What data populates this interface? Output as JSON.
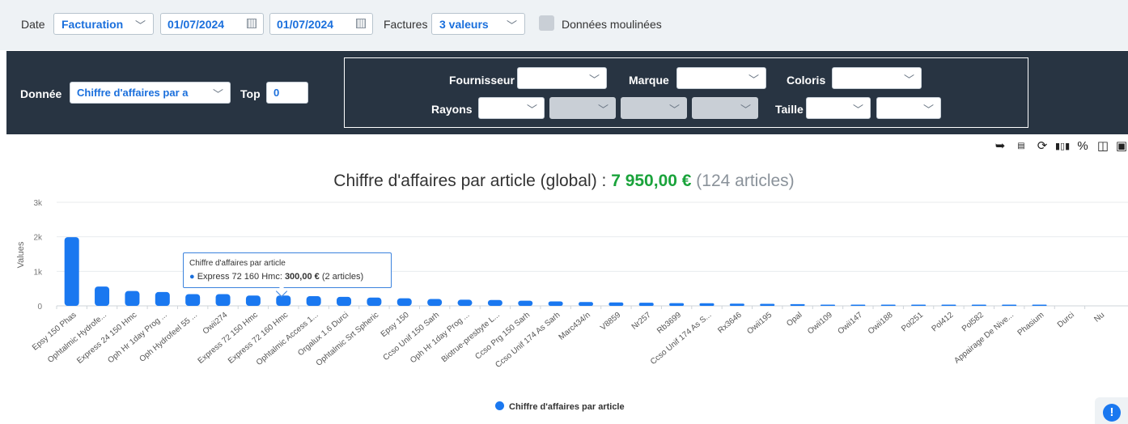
{
  "filters": {
    "date_label": "Date",
    "date_type": "Facturation",
    "date_start": "01/07/2024",
    "date_end": "01/07/2024",
    "factures_label": "Factures",
    "factures_value": "3 valeurs",
    "moulinees_label": "Données moulinées"
  },
  "panel": {
    "donnee_label": "Donnée",
    "donnee_value": "Chiffre d'affaires par a",
    "top_label": "Top",
    "top_value": "0",
    "fournisseur_label": "Fournisseur",
    "marque_label": "Marque",
    "coloris_label": "Coloris",
    "rayons_label": "Rayons",
    "taille_label": "Taille"
  },
  "toolbar": {
    "icons": [
      "export-icon",
      "csv-icon",
      "refresh-icon",
      "bar-chart-icon",
      "percent-icon",
      "columns-icon",
      "save-icon"
    ]
  },
  "chart": {
    "title_main": "Chiffre d'affaires par article (global) : ",
    "title_total": "7 950,00 €",
    "title_count": "(124 articles)",
    "y_axis_label": "Values",
    "legend_label": "Chiffre d'affaires par article",
    "tooltip_title": "Chiffre d'affaires par article",
    "tooltip_text": "Express 72 160 Hmc: ",
    "tooltip_value": "300,00 €",
    "tooltip_extra": "(2 articles)"
  },
  "chart_data": {
    "type": "bar",
    "ylim": [
      0,
      3000
    ],
    "yticks": [
      "0",
      "1k",
      "2k",
      "3k"
    ],
    "categories": [
      "Epsy 150 Phas",
      "Ophtalmic Hydrofe...",
      "Express 24 150 Hmc",
      "Oph Hr 1day Prog ...",
      "Oph Hydrofeel 55 ...",
      "Owii274",
      "Express 72 150 Hmc",
      "Express 72 160 Hmc",
      "Ophtalmic Access 1...",
      "Orgalux 1.6 Durci",
      "Ophtalmic Srt Spheric",
      "Epsy 150",
      "Ccso Unif 150 Sarh",
      "Oph Hr 1day Prog ...",
      "Biotrue-presbyte L...",
      "Ccso Prg 150 Sarh",
      "Ccso Unif 174 As Sarh",
      "Marc434/n",
      "V8859",
      "Nr257",
      "Rb3699",
      "Ccso Unif 174 As S...",
      "Rx3646",
      "Owii195",
      "Opal",
      "Owii109",
      "Owii147",
      "Owii188",
      "Pol251",
      "Pol412",
      "Pol582",
      "Appairage De Nive...",
      "Phasium",
      "Durci",
      "Nu"
    ],
    "values": [
      1990,
      560,
      430,
      400,
      340,
      340,
      300,
      300,
      280,
      260,
      240,
      220,
      200,
      180,
      170,
      150,
      130,
      110,
      100,
      90,
      80,
      75,
      65,
      60,
      50,
      6,
      5,
      4,
      3,
      2,
      2,
      1,
      1,
      0,
      0
    ],
    "colors": {
      "bar": "#1a78f0"
    }
  }
}
